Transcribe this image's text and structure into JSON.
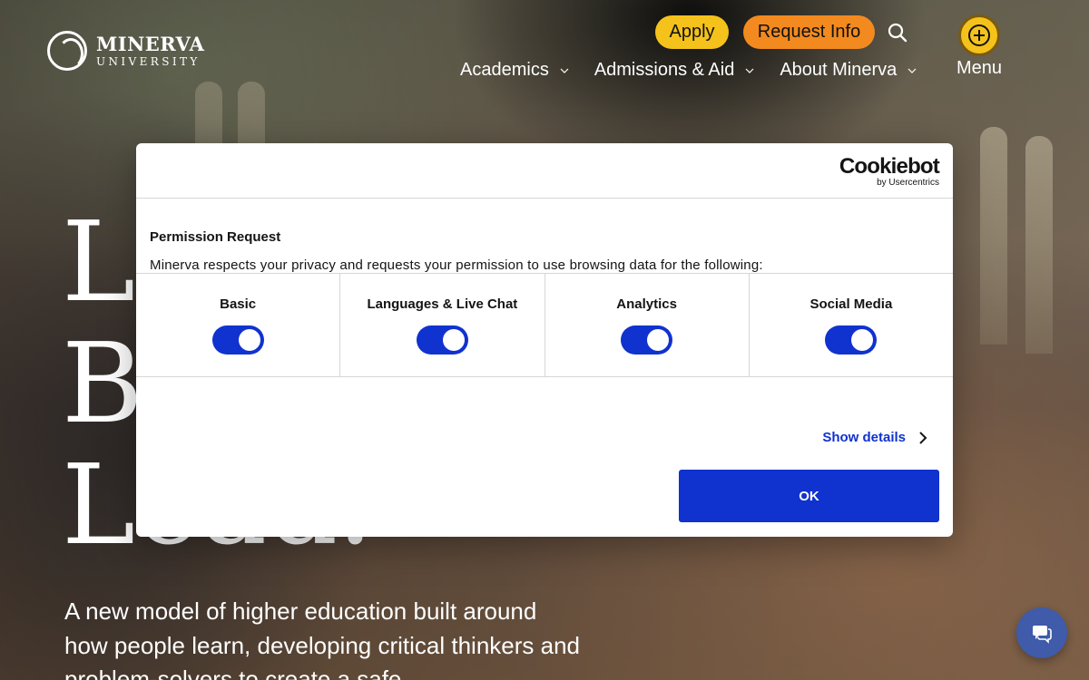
{
  "header": {
    "logo": {
      "name": "MINERVA",
      "sub": "UNIVERSITY"
    },
    "cta": {
      "apply": "Apply",
      "request_info": "Request Info"
    },
    "search_icon": "search-icon",
    "nav": [
      {
        "label": "Academics"
      },
      {
        "label": "Admissions & Aid"
      },
      {
        "label": "About Minerva"
      }
    ],
    "menu_label": "Menu",
    "colors": {
      "apply": "#f4c21b",
      "request_info": "#f38a1f"
    }
  },
  "hero": {
    "title_lines": [
      "L",
      "B",
      "L"
    ],
    "title_partial_tail": "ead.",
    "body": "A new model of higher education built around how people learn, developing critical thinkers and problem-solvers to create a safe,"
  },
  "cookie_dialog": {
    "brand": {
      "name": "Cookiebot",
      "by": "by Usercentrics"
    },
    "title": "Permission Request",
    "text": "Minerva respects your privacy and requests your permission to use browsing data for the following:",
    "consents": [
      {
        "label": "Basic",
        "enabled": true
      },
      {
        "label": "Languages & Live Chat",
        "enabled": true
      },
      {
        "label": "Analytics",
        "enabled": true
      },
      {
        "label": "Social Media",
        "enabled": true
      }
    ],
    "show_details": "Show details",
    "ok_label": "OK",
    "accent_color": "#1032cf"
  },
  "chat": {
    "icon": "chat-icon"
  }
}
